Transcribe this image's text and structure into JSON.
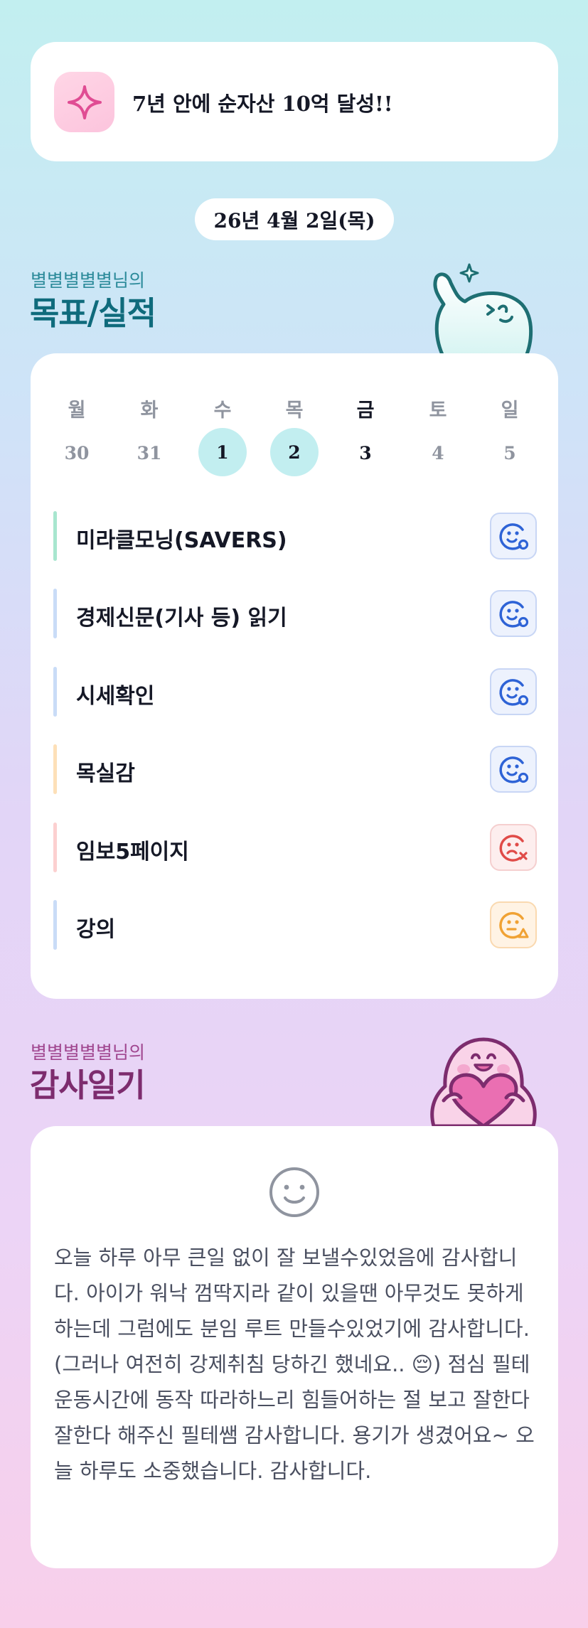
{
  "goal_banner": {
    "icon": "sparkle-icon",
    "text": "7년 안에 순자산 10억 달성!!"
  },
  "date": "26년 4월 2일(목)",
  "goals_section": {
    "subtitle": "별별별별별님의",
    "title": "목표/실적"
  },
  "calendar": {
    "weekdays": [
      "월",
      "화",
      "수",
      "목",
      "금",
      "토",
      "일"
    ],
    "days": [
      "30",
      "31",
      "1",
      "2",
      "3",
      "4",
      "5"
    ],
    "completed_days": [
      "1",
      "2"
    ],
    "today": "금"
  },
  "goals": [
    {
      "label": "미라클모닝(SAVERS)",
      "bar_color": "#a8e6cf",
      "status": "done",
      "status_icon": "smile-check-icon"
    },
    {
      "label": "경제신문(기사 등) 읽기",
      "bar_color": "#c9dcf7",
      "status": "done",
      "status_icon": "smile-check-icon"
    },
    {
      "label": "시세확인",
      "bar_color": "#c9dcf7",
      "status": "done",
      "status_icon": "smile-check-icon"
    },
    {
      "label": "목실감",
      "bar_color": "#fde0b8",
      "status": "done",
      "status_icon": "smile-check-icon"
    },
    {
      "label": "임보5페이지",
      "bar_color": "#fcd0d0",
      "status": "fail",
      "status_icon": "sad-x-icon"
    },
    {
      "label": "강의",
      "bar_color": "#c9dcf7",
      "status": "partial",
      "status_icon": "neutral-warning-icon"
    }
  ],
  "colors": {
    "done": "#2e63d6",
    "fail": "#e04b48",
    "partial": "#f0a234",
    "goals_title": "#0f6b7c",
    "diary_title": "#7d2c6e"
  },
  "diary_section": {
    "subtitle": "별별별별별님의",
    "title": "감사일기"
  },
  "diary": {
    "mood_icon": "smile-face-icon",
    "emoji": "😔",
    "text_before_emoji": "오늘 하루 아무 큰일 없이 잘 보낼수있었음에 감사합니다. 아이가 워낙 껌딱지라 같이 있을땐 아무것도 못하게 하는데 그럼에도 분임 루트 만들수있었기에 감사합니다. (그러나 여전히 강제취침 당하긴 했네요.. ",
    "text_after_emoji": ") 점심 필테 운동시간에 동작 따라하느리 힘들어하는 절 보고 잘한다 잘한다 해주신 필테쌤 감사합니다. 용기가 생겼어요~ 오늘 하루도 소중했습니다. 감사합니다."
  }
}
